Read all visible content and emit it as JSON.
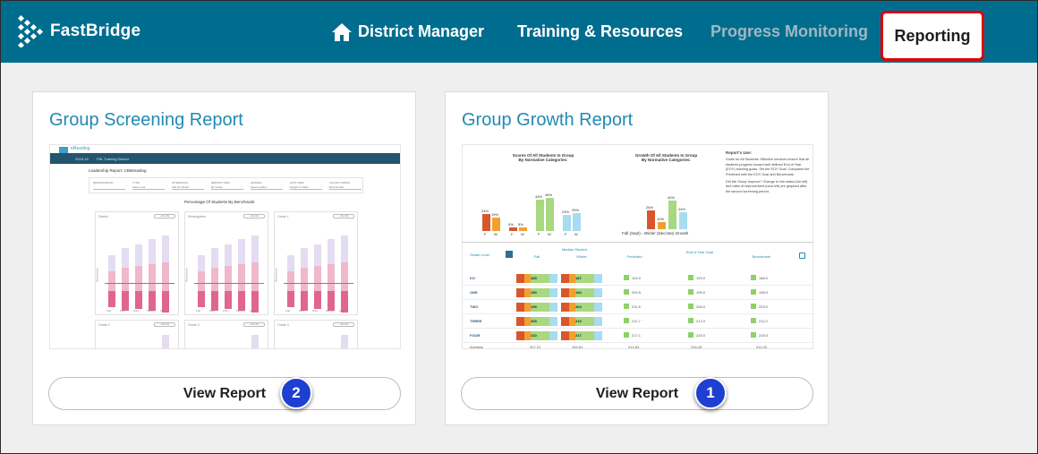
{
  "brand": {
    "name": "FastBridge"
  },
  "nav": {
    "district_manager": "District Manager",
    "training": "Training & Resources",
    "progress": "Progress Monitoring",
    "reporting": "Reporting"
  },
  "icons": {
    "home": "home-icon",
    "brand": "fastbridge-logo-icon"
  },
  "colors": {
    "header": "#006d8f",
    "accent": "#2189b4",
    "highlight": "#e00000",
    "step_badge": "#1e3fd0"
  },
  "cards": [
    {
      "title": "Group Screening Report",
      "button": "View Report",
      "step": "2"
    },
    {
      "title": "Group Growth Report",
      "button": "View Report",
      "step": "1"
    }
  ],
  "screening_thumb": {
    "app": "eReading",
    "year": "2018-19",
    "district": "FBL Training District",
    "heading": "Leadership Report: CBMreading",
    "filters": [
      "DEMOGRAPHIC",
      "TYPE",
      "INTERVAL(S)",
      "REPORT VIEW",
      "GRADES",
      "DATA VIEW",
      "COLOR CODING"
    ],
    "filter_values": [
      "",
      "Same year",
      "Fall 18, Winter",
      "By Grade",
      "Select grades",
      "Graphs & Table",
      "Benchmarks"
    ],
    "chart_title": "Percentage Of Students By Benchmark",
    "panels": [
      "District",
      "Kindergarten",
      "Grade 1"
    ],
    "panels_row2": [
      "Grade 2",
      "Grade 3",
      "Grade 4"
    ],
    "panel_button": "+ Stu info",
    "axis_label": "Benchmark",
    "x_labels": [
      "Fall",
      "Wint",
      "Wint",
      "Spring",
      "Sum"
    ]
  },
  "growth_thumb": {
    "left_title_1": "Scores Of All Students In Group",
    "left_title_2": "By Normative Categories:",
    "mid_title_1": "Growth Of All Students In Group",
    "mid_title_2": "By Normative Categories:",
    "mid_caption": "Fall (Sept) - Winter (Dec/Jan) Growth",
    "left_bars": [
      {
        "label": "24%",
        "color": "#d9562b",
        "value": 24
      },
      {
        "label": "19%",
        "color": "#f0a030",
        "value": 19
      },
      {
        "label": "5%",
        "color": "#d9562b",
        "value": 5
      },
      {
        "label": "5%",
        "color": "#f0a030",
        "value": 5
      },
      {
        "label": "44%",
        "color": "#a8d880",
        "value": 44
      },
      {
        "label": "46%",
        "color": "#a8d880",
        "value": 46
      },
      {
        "label": "23%",
        "color": "#a8dcf0",
        "value": 23
      },
      {
        "label": "25%",
        "color": "#a8dcf0",
        "value": 25
      }
    ],
    "left_ticks": [
      "F",
      "W",
      "F",
      "W",
      "F",
      "W",
      "F",
      "W"
    ],
    "mid_bars": [
      {
        "label": "26%",
        "color": "#d9562b",
        "value": 26
      },
      {
        "label": "10%",
        "color": "#f0a030",
        "value": 10
      },
      {
        "label": "40%",
        "color": "#a8d880",
        "value": 40
      },
      {
        "label": "24%",
        "color": "#a8dcf0",
        "value": 24
      }
    ],
    "side_title": "Report's Use:",
    "side_item_1": "Goals for All Students: Effective services ensure that all students progress toward well defined End of Year (EOY) learning goals. Set the EOY Goal. Compares the Predicted with the EOY Goal and Benchmark.",
    "side_item_2": "Did the Group Improve? Change to risk status (far left) and rates of improvement (near left) are graphed after the second screening period.",
    "headers": {
      "grade": "Grade Level",
      "median": "Median Student",
      "fall": "Fall",
      "winter": "Winter",
      "predicted": "Predicted",
      "goal": "End of Year Goal",
      "benchmark": "Benchmark",
      "score": "Score"
    },
    "rows": [
      {
        "grade": "KG",
        "fall": "165",
        "winter": "187",
        "predicted": "194.0",
        "goal": "193.0",
        "benchmark": "188.0"
      },
      {
        "grade": "ONE",
        "fall": "190",
        "winter": "194",
        "predicted": "200.5",
        "goal": "199.0",
        "benchmark": "198.0"
      },
      {
        "grade": "TWO",
        "fall": "199",
        "winter": "204",
        "predicted": "211.6",
        "goal": "208.0",
        "benchmark": "203.0"
      },
      {
        "grade": "THREE",
        "fall": "205",
        "winter": "210",
        "predicted": "211.7",
        "goal": "212.0",
        "benchmark": "211.0"
      },
      {
        "grade": "FOUR",
        "fall": "210",
        "winter": "217",
        "predicted": "217.1",
        "goal": "225.0",
        "benchmark": "218.0"
      }
    ],
    "average": {
      "label": "Average",
      "fall": "207.21",
      "winter": "194.81",
      "predicted": "212.64",
      "goal": "216.43",
      "benchmark": "211.03"
    }
  }
}
